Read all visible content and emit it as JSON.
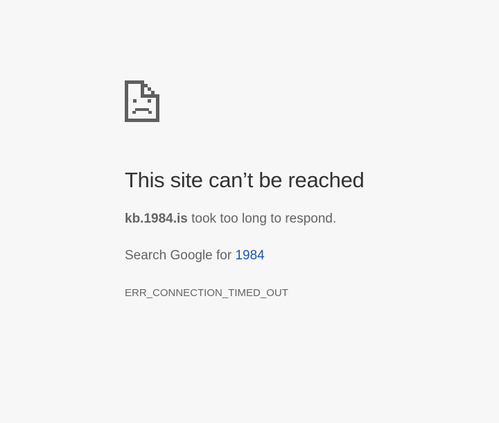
{
  "icon": "sad-page-icon",
  "error": {
    "title": "This site can’t be reached",
    "host": "kb.1984.is",
    "message_suffix": "took too long to respond.",
    "search_prefix": "Search Google for",
    "search_term": "1984",
    "code": "ERR_CONNECTION_TIMED_OUT"
  },
  "colors": {
    "background": "#f7f7f7",
    "title": "#333333",
    "text": "#646464",
    "link": "#2152b5",
    "icon": "#5f5f5f"
  }
}
